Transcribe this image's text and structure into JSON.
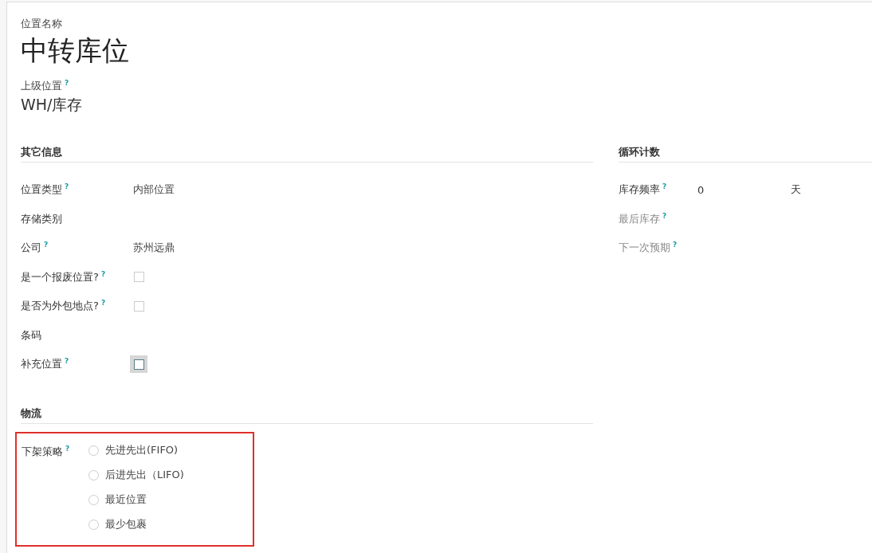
{
  "header": {
    "name_label": "位置名称",
    "name": "中转库位",
    "parent_label": "上级位置",
    "parent_help": "?",
    "parent": "WH/库存"
  },
  "other_info": {
    "title": "其它信息",
    "fields": [
      {
        "kind": "text",
        "label": "位置类型",
        "help": "?",
        "value": "内部位置"
      },
      {
        "kind": "text",
        "label": "存储类别"
      },
      {
        "kind": "text",
        "label": "公司",
        "help": "?",
        "value": "苏州远鼎"
      },
      {
        "kind": "checkbox",
        "label": "是一个报废位置?",
        "help": "?",
        "checked": false,
        "focused": false
      },
      {
        "kind": "checkbox",
        "label": "是否为外包地点?",
        "help": "?",
        "checked": false,
        "focused": false
      },
      {
        "kind": "text",
        "label": "条码"
      },
      {
        "kind": "checkbox",
        "label": "补充位置",
        "help": "?",
        "checked": false,
        "focused": true
      }
    ]
  },
  "cycle_count": {
    "title": "循环计数",
    "fields": [
      {
        "label": "库存频率",
        "help": "?",
        "value": "0",
        "unit": "天",
        "muted": false
      },
      {
        "label": "最后库存",
        "help": "?",
        "muted": true
      },
      {
        "label": "下一次预期",
        "help": "?",
        "muted": true
      }
    ]
  },
  "logistics": {
    "title": "物流",
    "label": "下架策略",
    "help": "?",
    "highlighted": true,
    "options": [
      {
        "label": "先进先出(FIFO)",
        "selected": false
      },
      {
        "label": "后进先出（LIFO)",
        "selected": false
      },
      {
        "label": "最近位置",
        "selected": false
      },
      {
        "label": "最少包裹",
        "selected": false
      }
    ]
  }
}
